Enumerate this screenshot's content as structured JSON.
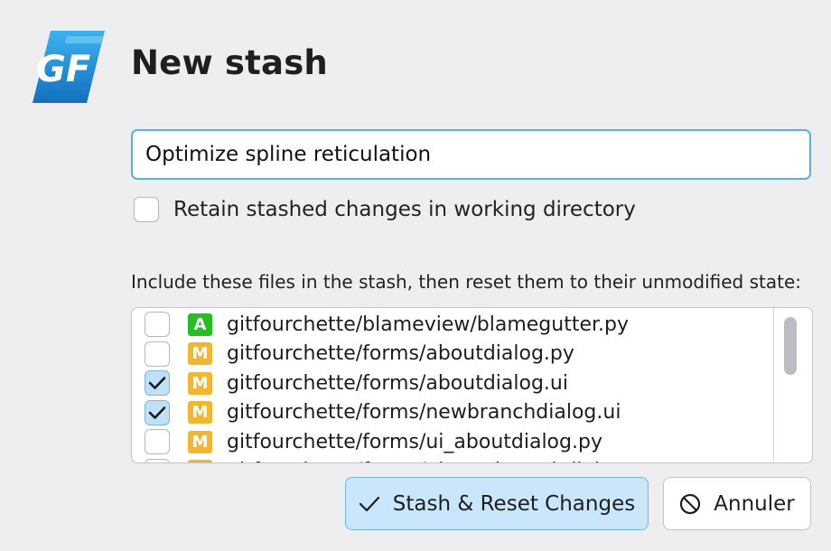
{
  "dialog": {
    "title": "New stash",
    "message": {
      "value": "Optimize spline reticulation",
      "placeholder": ""
    },
    "retain_option": {
      "label": "Retain stashed changes in working directory",
      "checked": false
    },
    "files_label": "Include these files in the stash, then reset them to their unmodified state:",
    "files": [
      {
        "checked": false,
        "status": "A",
        "status_color": "#22c022",
        "path": "gitfourchette/blameview/blamegutter.py"
      },
      {
        "checked": false,
        "status": "M",
        "status_color": "#f2b630",
        "path": "gitfourchette/forms/aboutdialog.py"
      },
      {
        "checked": true,
        "status": "M",
        "status_color": "#f2b630",
        "path": "gitfourchette/forms/aboutdialog.ui"
      },
      {
        "checked": true,
        "status": "M",
        "status_color": "#f2b630",
        "path": "gitfourchette/forms/newbranchdialog.ui"
      },
      {
        "checked": false,
        "status": "M",
        "status_color": "#f2b630",
        "path": "gitfourchette/forms/ui_aboutdialog.py"
      },
      {
        "checked": false,
        "status": "M",
        "status_color": "#f2b630",
        "path": "gitfourchette/forms/ui_newbranchdialog.py"
      }
    ],
    "buttons": {
      "ok_label": "Stash & Reset Changes",
      "ok_icon": "checkmark-icon",
      "cancel_label": "Annuler",
      "cancel_icon": "cancel-icon"
    }
  },
  "colors": {
    "accent": "#58b0e6",
    "background": "#eeeef0",
    "logo_blue": "#1e8fd6"
  }
}
